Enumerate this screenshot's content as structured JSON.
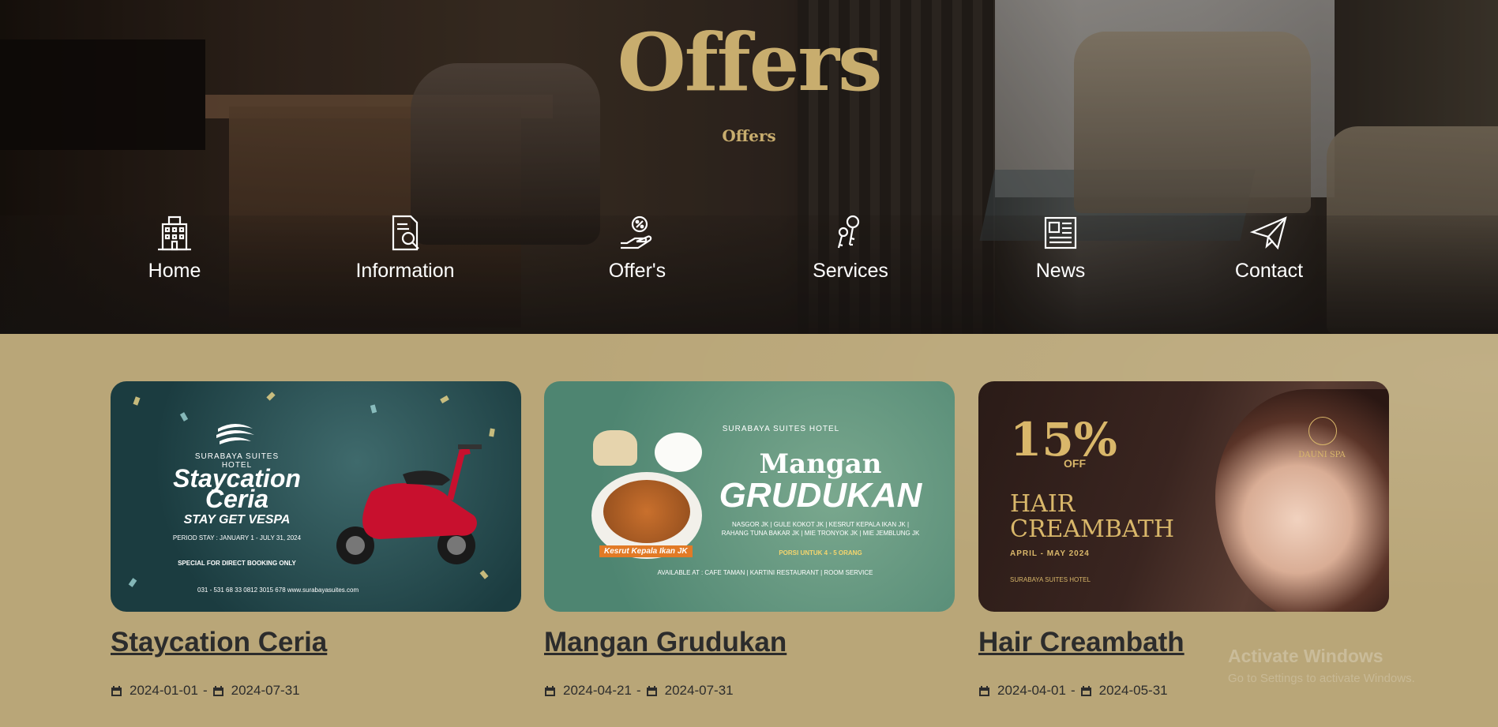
{
  "hero": {
    "title": "Offers",
    "subtitle": "Offers"
  },
  "nav": {
    "items": [
      {
        "label": "Home",
        "icon": "building-icon"
      },
      {
        "label": "Information",
        "icon": "document-search-icon"
      },
      {
        "label": "Offer's",
        "icon": "hand-discount-icon"
      },
      {
        "label": "Services",
        "icon": "keys-icon"
      },
      {
        "label": "News",
        "icon": "newspaper-icon"
      },
      {
        "label": "Contact",
        "icon": "paper-plane-icon"
      }
    ]
  },
  "offers": [
    {
      "title": "Staycation Ceria",
      "start": "2024-01-01",
      "end": "2024-07-31",
      "image": {
        "brand": "SURABAYA SUITES HOTEL",
        "headline": "Staycation Ceria",
        "tagline": "STAY GET VESPA",
        "period": "PERIOD STAY : JANUARY 1 - JULY 31, 2024",
        "special": "SPECIAL FOR DIRECT BOOKING ONLY",
        "footer": "031 - 531 68 33   0812 3015 678   www.surabayasuites.com"
      }
    },
    {
      "title": "Mangan Grudukan",
      "start": "2024-04-21",
      "end": "2024-07-31",
      "image": {
        "brand": "SURABAYA SUITES HOTEL",
        "headline": "Mangan",
        "headline2": "GRUDUKAN",
        "menu": "NASGOR JK | GULE KOKOT JK | KESRUT KEPALA IKAN JK | RAHANG TUNA BAKAR JK | MIE TRONYOK JK | MIE JEMBLUNG JK",
        "portion": "PORSI UNTUK 4 - 5 ORANG",
        "tag": "Kesrut Kepala Ikan JK",
        "footer": "AVAILABLE AT : CAFE TAMAN | KARTINI RESTAURANT | ROOM SERVICE"
      }
    },
    {
      "title": "Hair Creambath",
      "start": "2024-04-01",
      "end": "2024-05-31",
      "image": {
        "percent": "15%",
        "off": "OFF",
        "headline": "HAIR CREAMBATH",
        "dates": "APRIL - MAY 2024",
        "spa": "DAUNI SPA",
        "footer": "SURABAYA SUITES HOTEL"
      }
    }
  ],
  "date_separator": "-",
  "watermark": {
    "line1": "Activate Windows",
    "line2": "Go to Settings to activate Windows."
  },
  "colors": {
    "gold": "#c8ad6e",
    "section_bg": "#b9a678",
    "text_dark": "#2c2c2c"
  }
}
